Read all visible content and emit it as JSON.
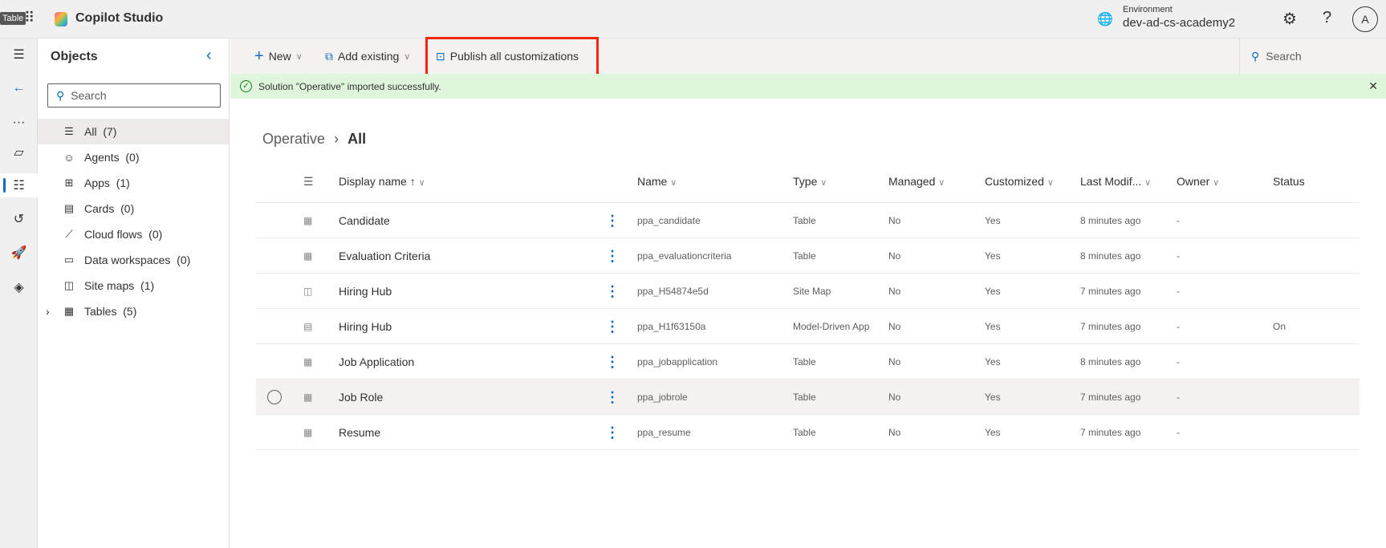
{
  "app": {
    "title": "Copilot Studio",
    "tooltip": "Table",
    "environment_label": "Environment",
    "environment": "dev-ad-cs-academy2",
    "avatar": "A"
  },
  "objects": {
    "title": "Objects",
    "search_placeholder": "Search",
    "items": [
      {
        "label": "All",
        "count": "(7)",
        "icon": "list-icon"
      },
      {
        "label": "Agents",
        "count": "(0)",
        "icon": "bot-icon"
      },
      {
        "label": "Apps",
        "count": "(1)",
        "icon": "apps-icon"
      },
      {
        "label": "Cards",
        "count": "(0)",
        "icon": "card-icon"
      },
      {
        "label": "Cloud flows",
        "count": "(0)",
        "icon": "flow-icon"
      },
      {
        "label": "Data workspaces",
        "count": "(0)",
        "icon": "folder-icon"
      },
      {
        "label": "Site maps",
        "count": "(1)",
        "icon": "sitemap-icon"
      },
      {
        "label": "Tables",
        "count": "(5)",
        "icon": "table-icon"
      }
    ]
  },
  "toolbar": {
    "new": "New",
    "add_existing": "Add existing",
    "publish": "Publish all customizations",
    "search": "Search",
    "highlight_color": "#f4260f"
  },
  "banner": {
    "message": "Solution \"Operative\" imported successfully."
  },
  "breadcrumb": {
    "parent": "Operative",
    "current": "All"
  },
  "table": {
    "headers": {
      "display_name": "Display name",
      "name": "Name",
      "type": "Type",
      "managed": "Managed",
      "customized": "Customized",
      "last_modified": "Last Modif...",
      "owner": "Owner",
      "status": "Status"
    },
    "rows": [
      {
        "display_name": "Candidate",
        "name": "ppa_candidate",
        "type": "Table",
        "managed": "No",
        "customized": "Yes",
        "last_modified": "8 minutes ago",
        "owner": "-",
        "status": ""
      },
      {
        "display_name": "Evaluation Criteria",
        "name": "ppa_evaluationcriteria",
        "type": "Table",
        "managed": "No",
        "customized": "Yes",
        "last_modified": "8 minutes ago",
        "owner": "-",
        "status": ""
      },
      {
        "display_name": "Hiring Hub",
        "name": "ppa_H54874e5d",
        "type": "Site Map",
        "managed": "No",
        "customized": "Yes",
        "last_modified": "7 minutes ago",
        "owner": "-",
        "status": ""
      },
      {
        "display_name": "Hiring Hub",
        "name": "ppa_H1f63150a",
        "type": "Model-Driven App",
        "managed": "No",
        "customized": "Yes",
        "last_modified": "7 minutes ago",
        "owner": "-",
        "status": "On"
      },
      {
        "display_name": "Job Application",
        "name": "ppa_jobapplication",
        "type": "Table",
        "managed": "No",
        "customized": "Yes",
        "last_modified": "8 minutes ago",
        "owner": "-",
        "status": ""
      },
      {
        "display_name": "Job Role",
        "name": "ppa_jobrole",
        "type": "Table",
        "managed": "No",
        "customized": "Yes",
        "last_modified": "7 minutes ago",
        "owner": "-",
        "status": ""
      },
      {
        "display_name": "Resume",
        "name": "ppa_resume",
        "type": "Table",
        "managed": "No",
        "customized": "Yes",
        "last_modified": "7 minutes ago",
        "owner": "-",
        "status": ""
      }
    ]
  }
}
